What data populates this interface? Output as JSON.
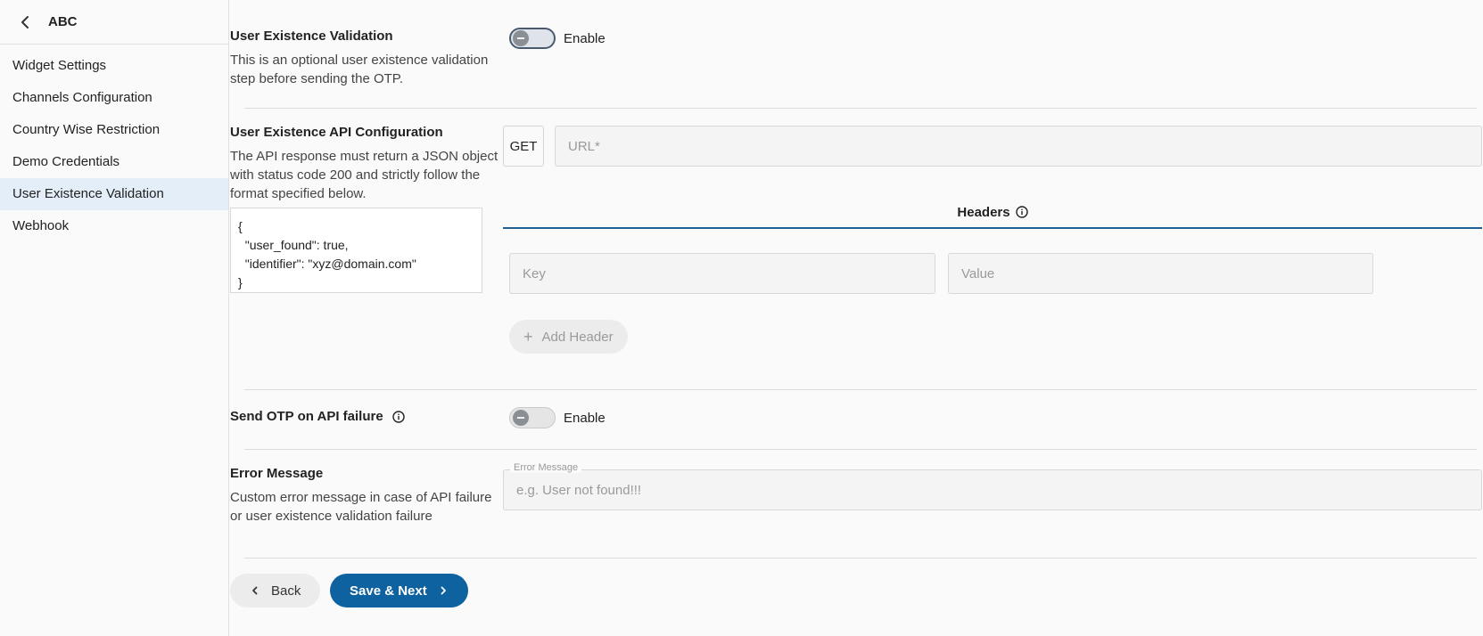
{
  "sidebar": {
    "title": "ABC",
    "items": [
      {
        "label": "Widget Settings"
      },
      {
        "label": "Channels Configuration"
      },
      {
        "label": "Country Wise Restriction"
      },
      {
        "label": "Demo Credentials"
      },
      {
        "label": "User Existence Validation",
        "active": true
      },
      {
        "label": "Webhook"
      }
    ]
  },
  "user_existence": {
    "title": "User Existence Validation",
    "desc_line1": "This is an optional user existence validation",
    "desc_line2": "step before sending the OTP.",
    "toggle_label": "Enable"
  },
  "api_config": {
    "title": "User Existence API Configuration",
    "desc_line1": "The API response must return a JSON object",
    "desc_line2": "with status code 200 and strictly follow the",
    "desc_line3": "format specified below.",
    "json_sample": "{\n  \"user_found\": true,\n  \"identifier\": \"xyz@domain.com\"\n}",
    "method": "GET",
    "url_placeholder": "URL*",
    "headers_tab": "Headers",
    "key_placeholder": "Key",
    "value_placeholder": "Value",
    "add_header": "Add Header"
  },
  "send_otp": {
    "title": "Send OTP on API failure",
    "toggle_label": "Enable"
  },
  "error_message": {
    "title": "Error Message",
    "desc_line1": "Custom error message in case of API failure",
    "desc_line2": "or user existence validation failure",
    "field_label": "Error Message",
    "placeholder": "e.g. User not found!!!"
  },
  "footer": {
    "back_label": "Back",
    "save_label": "Save & Next"
  },
  "colors": {
    "accent": "#0f62a0",
    "active_nav": "#e3eef9"
  }
}
